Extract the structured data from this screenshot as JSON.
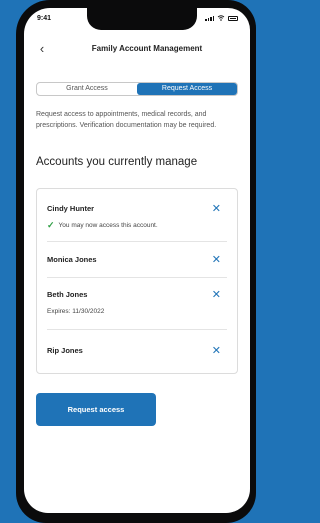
{
  "status_bar": {
    "time": "9:41"
  },
  "nav": {
    "title": "Family Account Management"
  },
  "tabs": [
    {
      "label": "Grant Access",
      "selected": false
    },
    {
      "label": "Request Access",
      "selected": true
    }
  ],
  "intro_text": "Request access to appointments, medical records, and prescriptions. Verification documentation may be required.",
  "section_title": "Accounts you currently manage",
  "accounts": [
    {
      "name": "Cindy Hunter",
      "note": "You may now access this account."
    },
    {
      "name": "Monica Jones"
    },
    {
      "name": "Beth Jones",
      "note": "Expires: 11/30/2022"
    },
    {
      "name": "Rip Jones"
    }
  ],
  "primary_button": {
    "label": "Request access"
  },
  "colors": {
    "accent": "#1f73b7",
    "success": "#2f9e44",
    "background": "#1f73b7"
  }
}
